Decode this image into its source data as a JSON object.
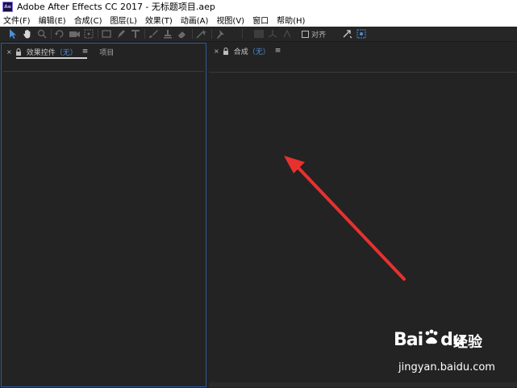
{
  "window": {
    "title": "Adobe After Effects CC 2017 - 无标题项目.aep",
    "app_icon": "Ae"
  },
  "menu": [
    "文件(F)",
    "编辑(E)",
    "合成(C)",
    "图层(L)",
    "效果(T)",
    "动画(A)",
    "视图(V)",
    "窗口",
    "帮助(H)"
  ],
  "toolbar": {
    "snap_label": "对齐"
  },
  "left_panel": {
    "close": "×",
    "tab_label": "效果控件",
    "tab_value": "（无）",
    "menu": "≡",
    "project_tab": "项目"
  },
  "right_panel": {
    "close": "×",
    "tab_label": "合成",
    "tab_value": "（无）",
    "menu": "≡"
  },
  "watermark": {
    "logo": "Bai",
    "logo2": "du",
    "jingyan": "经验",
    "url": "jingyan.baidu.com"
  },
  "colors": {
    "accent_blue": "#4d8fd8",
    "arrow_red": "#e8312f",
    "panel_bg": "#232323"
  }
}
